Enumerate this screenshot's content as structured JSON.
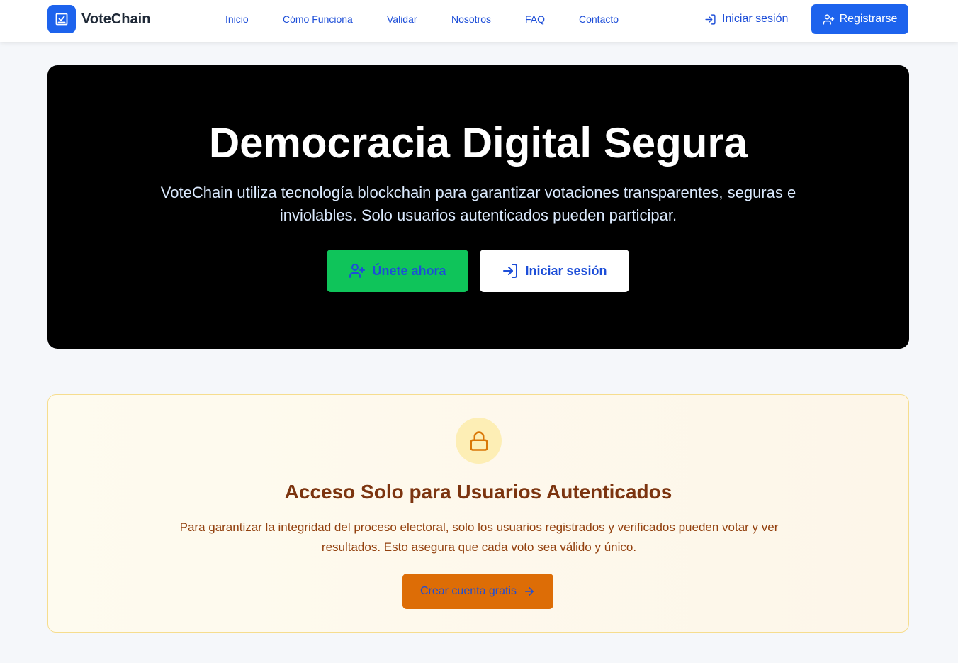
{
  "brand": {
    "name": "VoteChain",
    "logo_icon": "ballot-box-icon",
    "accent_color": "#1d63ed"
  },
  "nav": {
    "links": [
      {
        "label": "Inicio"
      },
      {
        "label": "Cómo Funciona"
      },
      {
        "label": "Validar"
      },
      {
        "label": "Nosotros"
      },
      {
        "label": "FAQ"
      },
      {
        "label": "Contacto"
      }
    ],
    "login_label": "Iniciar sesión",
    "login_icon": "log-in-icon",
    "register_label": "Registrarse",
    "register_icon": "user-plus-icon"
  },
  "hero": {
    "title": "Democracia Digital Segura",
    "subtitle": "VoteChain utiliza tecnología blockchain para garantizar votaciones transparentes, seguras e inviolables. Solo usuarios autenticados pueden participar.",
    "join_label": "Únete ahora",
    "join_icon": "user-plus-icon",
    "login_label": "Iniciar sesión",
    "login_icon": "log-in-icon",
    "background_color": "#000000",
    "join_color": "#0fc45a"
  },
  "notice": {
    "icon": "lock-icon",
    "title": "Acceso Solo para Usuarios Autenticados",
    "text": "Para garantizar la integridad del proceso electoral, solo los usuarios registrados y verificados pueden votar y ver resultados. Esto asegura que cada voto sea válido y único.",
    "button_label": "Crear cuenta gratis",
    "button_icon": "arrow-right-icon",
    "button_color": "#dd6d06"
  }
}
